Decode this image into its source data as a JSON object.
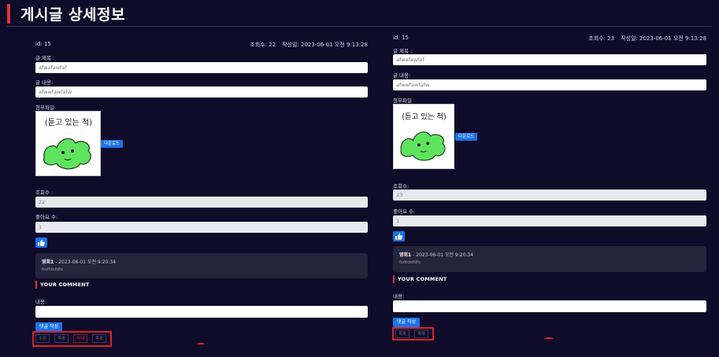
{
  "header": {
    "title": "게시글 상세정보"
  },
  "left_panel": {
    "id_label": "id: 15",
    "views_meta": "조회수: 22",
    "date_meta": "작성일: 2023-06-01 오전 9:13:28",
    "title_label": "글 제목 :",
    "title_value": "afwafawfaf",
    "content_label": "글 내용:",
    "content_value": "afwwfawfafw",
    "attach_label": "첨부파일",
    "image_caption": "(듣고 있는 척)",
    "download_label": "다운로드",
    "views_label": "조회수 :",
    "views_value": "22",
    "likes_label": "좋아요 수:",
    "likes_value": "1",
    "like_icon": "thumbs-up-icon",
    "comment_author": "영희1",
    "comment_date": " - 2023-06-01 오전 9:20:34",
    "comment_text": "fsdfdsfdfs",
    "your_comment": "YOUR COMMENT",
    "reply_label": "내용:",
    "submit_label": "댓글 작성",
    "actions": [
      "수정",
      "목록",
      "삭제",
      "목록"
    ]
  },
  "right_panel": {
    "id_label": "id: 15",
    "views_meta": "조회수: 23",
    "date_meta": "작성일: 2023-06-01 오전 9:13:28",
    "title_label": "글 제목 :",
    "title_value": "afwafawfaf",
    "content_label": "글 내용:",
    "content_value": "afwwfawfafw",
    "attach_label": "첨부파일",
    "image_caption": "(듣고 있는 척)",
    "download_label": "다운로드",
    "views_label": "조회수:",
    "views_value": "23",
    "likes_label": "좋아요 수:",
    "likes_value": "1",
    "like_icon": "thumbs-up-icon",
    "comment_author": "영희1",
    "comment_date": " - 2023-06-01 오전 9:20:34",
    "comment_text": "fsdfdsfdfs",
    "your_comment": "YOUR COMMENT",
    "reply_label": "내용:",
    "submit_label": "댓글 작성",
    "actions": [
      "목록",
      "목록"
    ]
  },
  "colors": {
    "background": "#0f0c2a",
    "accent_red": "#e3343c",
    "button_blue": "#1a73e8",
    "highlight_box": "#e0202a"
  }
}
